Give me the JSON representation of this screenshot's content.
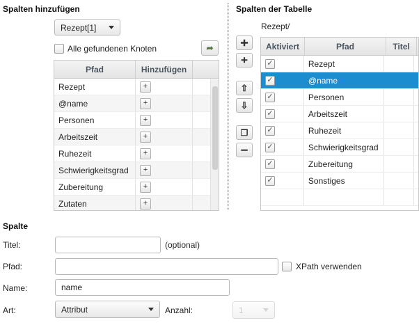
{
  "left_panel": {
    "title": "Spalten hinzufügen",
    "context_dropdown": "Rezept[1]",
    "all_nodes_label": "Alle gefundenen Knoten",
    "table": {
      "headers": [
        "Pfad",
        "Hinzufügen"
      ],
      "rows": [
        {
          "path": "Rezept"
        },
        {
          "path": "@name"
        },
        {
          "path": "Personen"
        },
        {
          "path": "Arbeitszeit"
        },
        {
          "path": "Ruhezeit"
        },
        {
          "path": "Schwierigkeitsgrad"
        },
        {
          "path": "Zubereitung"
        },
        {
          "path": "Zutaten"
        }
      ],
      "add_symbol": "+"
    }
  },
  "right_panel": {
    "title": "Spalten der Tabelle",
    "context_path": "Rezept/",
    "table": {
      "headers": [
        "Aktiviert",
        "Pfad",
        "Titel"
      ],
      "rows": [
        {
          "path": "Rezept",
          "active": true,
          "selected": false
        },
        {
          "path": "@name",
          "active": true,
          "selected": true
        },
        {
          "path": "Personen",
          "active": true,
          "selected": false
        },
        {
          "path": "Arbeitszeit",
          "active": true,
          "selected": false
        },
        {
          "path": "Ruhezeit",
          "active": true,
          "selected": false
        },
        {
          "path": "Schwierigkeitsgrad",
          "active": true,
          "selected": false
        },
        {
          "path": "Zubereitung",
          "active": true,
          "selected": false
        },
        {
          "path": "Sonstiges",
          "active": true,
          "selected": false
        }
      ]
    },
    "side_buttons": [
      "add-icon",
      "add-after-icon",
      "move-up-icon",
      "move-down-icon",
      "duplicate-icon",
      "remove-icon"
    ]
  },
  "spalte": {
    "title": "Spalte",
    "titel_label": "Titel:",
    "titel_value": "",
    "optional_hint": "(optional)",
    "pfad_label": "Pfad:",
    "pfad_value": "",
    "xpath_label": "XPath verwenden",
    "name_label": "Name:",
    "name_value": "name",
    "art_label": "Art:",
    "art_value": "Attribut",
    "anzahl_label": "Anzahl:",
    "anzahl_value": "1"
  },
  "colors": {
    "selection": "#1c8ecf",
    "header_text": "#4a5560"
  }
}
